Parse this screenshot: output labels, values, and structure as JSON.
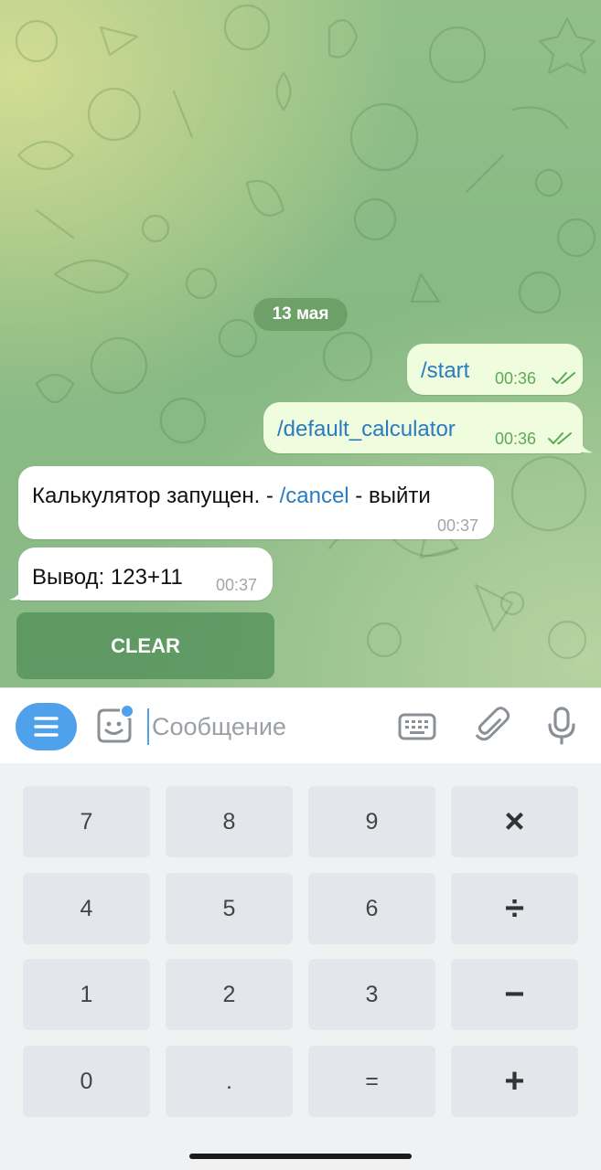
{
  "chat": {
    "date_label": "13 мая",
    "messages": [
      {
        "direction": "out",
        "text": "/start",
        "time": "00:36",
        "status": "read"
      },
      {
        "direction": "out",
        "text": "/default_calculator",
        "time": "00:36",
        "status": "read"
      },
      {
        "direction": "in",
        "text_prefix": "Калькулятор запущен. - ",
        "link": "/cancel",
        "text_suffix": " - выйти",
        "time": "00:37"
      },
      {
        "direction": "in",
        "text": "Вывод: 123+11",
        "time": "00:37"
      }
    ],
    "inline_button": {
      "label": "CLEAR"
    }
  },
  "input_bar": {
    "placeholder": "Сообщение",
    "value": "",
    "icons": [
      "menu-icon",
      "sticker-icon",
      "keyboard-icon",
      "paperclip-icon",
      "microphone-icon"
    ],
    "accent": "#4ea1ea"
  },
  "keypad": {
    "rows": [
      [
        "7",
        "8",
        "9",
        "×"
      ],
      [
        "4",
        "5",
        "6",
        "÷"
      ],
      [
        "1",
        "2",
        "3",
        "−"
      ],
      [
        "0",
        ".",
        "=",
        "+"
      ]
    ]
  },
  "colors": {
    "outgoing_bubble": "#effdde",
    "incoming_bubble": "#ffffff",
    "link": "#2a7bc0",
    "check": "#5fa859"
  }
}
